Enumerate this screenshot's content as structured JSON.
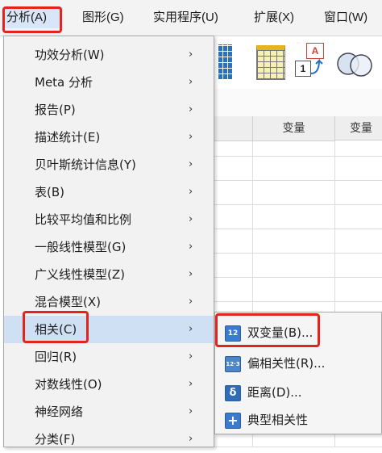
{
  "menubar": {
    "items": [
      {
        "label": "分析(A)"
      },
      {
        "label": "图形(G)"
      },
      {
        "label": "实用程序(U)"
      },
      {
        "label": "扩展(X)"
      },
      {
        "label": "窗口(W)"
      }
    ]
  },
  "spreadsheet": {
    "columns": [
      "变量",
      "变量"
    ]
  },
  "analyze_menu": {
    "items": [
      {
        "label": "功效分析(W)"
      },
      {
        "label": "Meta 分析"
      },
      {
        "label": "报告(P)"
      },
      {
        "label": "描述统计(E)"
      },
      {
        "label": "贝叶斯统计信息(Y)"
      },
      {
        "label": "表(B)"
      },
      {
        "label": "比较平均值和比例"
      },
      {
        "label": "一般线性模型(G)"
      },
      {
        "label": "广义线性模型(Z)"
      },
      {
        "label": "混合模型(X)"
      },
      {
        "label": "相关(C)"
      },
      {
        "label": "回归(R)"
      },
      {
        "label": "对数线性(O)"
      },
      {
        "label": "神经网络"
      },
      {
        "label": "分类(F)"
      }
    ],
    "arrow": "›"
  },
  "correlate_submenu": {
    "items": [
      {
        "label": "双变量(B)...",
        "icon": "bivariate-icon",
        "icon_text": "12"
      },
      {
        "label": "偏相关性(R)...",
        "icon": "partial-correlation-icon",
        "icon_text": "12·3"
      },
      {
        "label": "距离(D)...",
        "icon": "distances-icon",
        "icon_text": "δ"
      },
      {
        "label": "典型相关性",
        "icon": "canonical-correlation-icon",
        "icon_text": "+"
      }
    ]
  },
  "toolbar": {
    "value_label_badge": "1",
    "value_label_letter": "A"
  },
  "colors": {
    "highlight_red": "#e3241b",
    "active_item": "#cfe0f5",
    "icon_blue": "#2a6fc0"
  }
}
